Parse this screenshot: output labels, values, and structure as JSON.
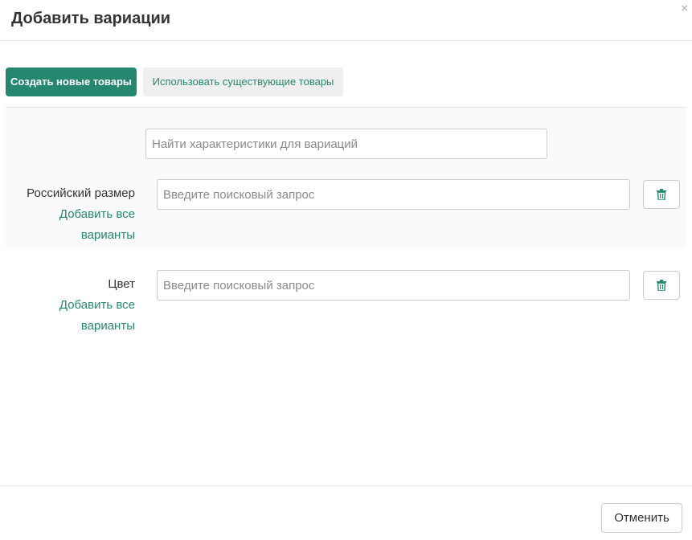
{
  "modal": {
    "title": "Добавить вариации",
    "close_glyph": "×"
  },
  "tabs": [
    {
      "label": "Создать новые товары",
      "active": true
    },
    {
      "label": "Использовать существующие товары",
      "active": false
    }
  ],
  "search": {
    "placeholder": "Найти характеристики для вариаций",
    "value": ""
  },
  "attributes": [
    {
      "label": "Российский размер",
      "add_all_line1": "Добавить все",
      "add_all_line2": "варианты",
      "query_placeholder": "Введите поисковый запрос",
      "query_value": "",
      "delete_icon": "trash-icon"
    },
    {
      "label": "Цвет",
      "add_all_line1": "Добавить все",
      "add_all_line2": "варианты",
      "query_placeholder": "Введите поисковый запрос",
      "query_value": "",
      "delete_icon": "trash-icon"
    }
  ],
  "footer": {
    "cancel_label": "Отменить"
  },
  "colors": {
    "accent": "#26876f",
    "inactive_tab_bg": "#efefef",
    "panel_bg": "#fafafa"
  }
}
